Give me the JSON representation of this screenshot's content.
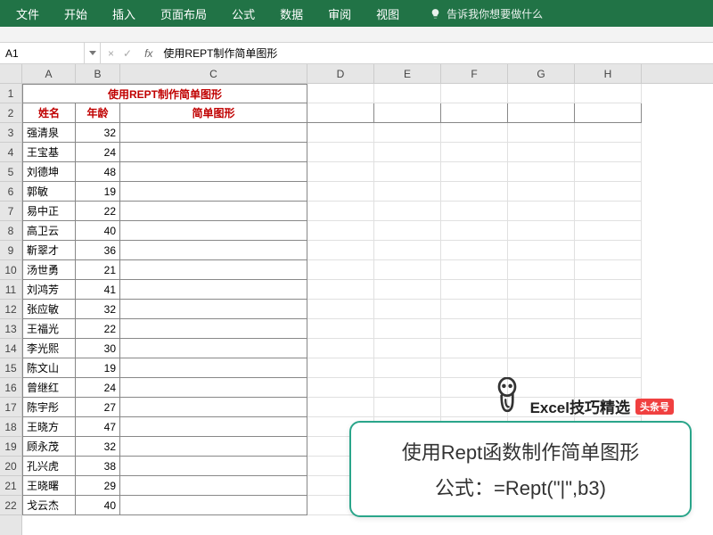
{
  "ribbon": {
    "tabs": [
      "文件",
      "开始",
      "插入",
      "页面布局",
      "公式",
      "数据",
      "审阅",
      "视图"
    ],
    "active_index": 1,
    "tell_me": "告诉我你想要做什么"
  },
  "formula_bar": {
    "name_box": "A1",
    "cancel": "×",
    "confirm": "✓",
    "fx": "fx",
    "formula": "使用REPT制作简单图形"
  },
  "columns": [
    "A",
    "B",
    "C",
    "D",
    "E",
    "F",
    "G",
    "H"
  ],
  "row_count": 22,
  "sheet": {
    "title": "使用REPT制作简单图形",
    "headers": {
      "name": "姓名",
      "age": "年龄",
      "chart": "简单图形"
    },
    "rows": [
      {
        "name": "强清泉",
        "age": "32"
      },
      {
        "name": "王宝基",
        "age": "24"
      },
      {
        "name": "刘德坤",
        "age": "48"
      },
      {
        "name": "郭敏",
        "age": "19"
      },
      {
        "name": "易中正",
        "age": "22"
      },
      {
        "name": "高卫云",
        "age": "40"
      },
      {
        "name": "靳翠才",
        "age": "36"
      },
      {
        "name": "汤世勇",
        "age": "21"
      },
      {
        "name": "刘鸿芳",
        "age": "41"
      },
      {
        "name": "张应敏",
        "age": "32"
      },
      {
        "name": "王福光",
        "age": "22"
      },
      {
        "name": "李光熙",
        "age": "30"
      },
      {
        "name": "陈文山",
        "age": "19"
      },
      {
        "name": "曾继红",
        "age": "24"
      },
      {
        "name": "陈宇彤",
        "age": "27"
      },
      {
        "name": "王晓方",
        "age": "47"
      },
      {
        "name": "顾永茂",
        "age": "32"
      },
      {
        "name": "孔兴虎",
        "age": "38"
      },
      {
        "name": "王晓曙",
        "age": "29"
      },
      {
        "name": "戈云杰",
        "age": "40"
      }
    ]
  },
  "tip": {
    "brand": "Excel技巧精选",
    "badge": "头条号",
    "line1": "使用Rept函数制作简单图形",
    "line2": "公式：=Rept(\"|\",b3)"
  }
}
